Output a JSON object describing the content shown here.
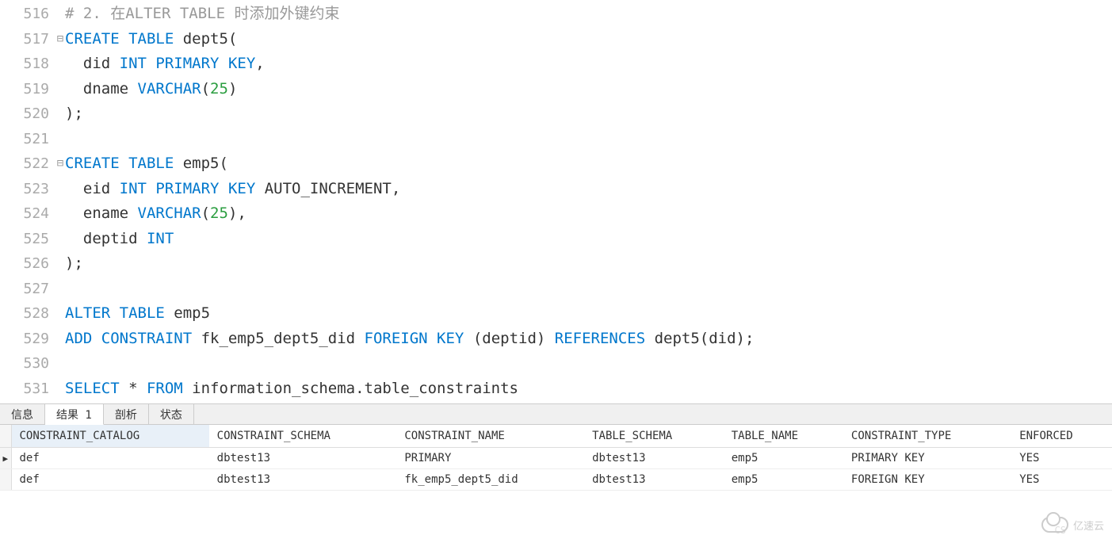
{
  "editor": {
    "lines": [
      {
        "num": "516",
        "fold": "",
        "tokens": [
          {
            "t": "# 2. 在ALTER TABLE 时添加外键约束",
            "c": "comment"
          }
        ]
      },
      {
        "num": "517",
        "fold": "⊟",
        "tokens": [
          {
            "t": "CREATE",
            "c": "kw"
          },
          {
            "t": " "
          },
          {
            "t": "TABLE",
            "c": "kw"
          },
          {
            "t": " dept5("
          }
        ]
      },
      {
        "num": "518",
        "fold": "",
        "tokens": [
          {
            "t": "  did "
          },
          {
            "t": "INT",
            "c": "kw"
          },
          {
            "t": " "
          },
          {
            "t": "PRIMARY",
            "c": "kw"
          },
          {
            "t": " "
          },
          {
            "t": "KEY",
            "c": "kw"
          },
          {
            "t": ","
          }
        ]
      },
      {
        "num": "519",
        "fold": "",
        "tokens": [
          {
            "t": "  dname "
          },
          {
            "t": "VARCHAR",
            "c": "kw"
          },
          {
            "t": "("
          },
          {
            "t": "25",
            "c": "num"
          },
          {
            "t": ")"
          }
        ]
      },
      {
        "num": "520",
        "fold": "",
        "tokens": [
          {
            "t": ");"
          }
        ]
      },
      {
        "num": "521",
        "fold": "",
        "tokens": [
          {
            "t": ""
          }
        ]
      },
      {
        "num": "522",
        "fold": "⊟",
        "tokens": [
          {
            "t": "CREATE",
            "c": "kw"
          },
          {
            "t": " "
          },
          {
            "t": "TABLE",
            "c": "kw"
          },
          {
            "t": " emp5("
          }
        ]
      },
      {
        "num": "523",
        "fold": "",
        "tokens": [
          {
            "t": "  eid "
          },
          {
            "t": "INT",
            "c": "kw"
          },
          {
            "t": " "
          },
          {
            "t": "PRIMARY",
            "c": "kw"
          },
          {
            "t": " "
          },
          {
            "t": "KEY",
            "c": "kw"
          },
          {
            "t": " AUTO_INCREMENT,"
          }
        ]
      },
      {
        "num": "524",
        "fold": "",
        "tokens": [
          {
            "t": "  ename "
          },
          {
            "t": "VARCHAR",
            "c": "kw"
          },
          {
            "t": "("
          },
          {
            "t": "25",
            "c": "num"
          },
          {
            "t": "),"
          }
        ]
      },
      {
        "num": "525",
        "fold": "",
        "tokens": [
          {
            "t": "  deptid "
          },
          {
            "t": "INT",
            "c": "kw"
          }
        ]
      },
      {
        "num": "526",
        "fold": "",
        "tokens": [
          {
            "t": ");"
          }
        ]
      },
      {
        "num": "527",
        "fold": "",
        "tokens": [
          {
            "t": ""
          }
        ]
      },
      {
        "num": "528",
        "fold": "",
        "tokens": [
          {
            "t": "ALTER",
            "c": "kw"
          },
          {
            "t": " "
          },
          {
            "t": "TABLE",
            "c": "kw"
          },
          {
            "t": " emp5"
          }
        ]
      },
      {
        "num": "529",
        "fold": "",
        "tokens": [
          {
            "t": "ADD",
            "c": "kw"
          },
          {
            "t": " "
          },
          {
            "t": "CONSTRAINT",
            "c": "kw"
          },
          {
            "t": " fk_emp5_dept5_did "
          },
          {
            "t": "FOREIGN",
            "c": "kw"
          },
          {
            "t": " "
          },
          {
            "t": "KEY",
            "c": "kw"
          },
          {
            "t": " (deptid) "
          },
          {
            "t": "REFERENCES",
            "c": "kw"
          },
          {
            "t": " dept5(did);"
          }
        ]
      },
      {
        "num": "530",
        "fold": "",
        "tokens": [
          {
            "t": ""
          }
        ]
      },
      {
        "num": "531",
        "fold": "",
        "tokens": [
          {
            "t": "SELECT",
            "c": "kw"
          },
          {
            "t": " * "
          },
          {
            "t": "FROM",
            "c": "kw"
          },
          {
            "t": " information_schema.table_constraints"
          }
        ]
      }
    ]
  },
  "tabs": {
    "items": [
      "信息",
      "结果 1",
      "剖析",
      "状态"
    ],
    "active_index": 1
  },
  "results": {
    "columns": [
      "CONSTRAINT_CATALOG",
      "CONSTRAINT_SCHEMA",
      "CONSTRAINT_NAME",
      "TABLE_SCHEMA",
      "TABLE_NAME",
      "CONSTRAINT_TYPE",
      "ENFORCED"
    ],
    "rows": [
      {
        "marker": "▶",
        "cells": [
          "def",
          "dbtest13",
          "PRIMARY",
          "dbtest13",
          "emp5",
          "PRIMARY KEY",
          "YES"
        ]
      },
      {
        "marker": "",
        "cells": [
          "def",
          "dbtest13",
          "fk_emp5_dept5_did",
          "dbtest13",
          "emp5",
          "FOREIGN KEY",
          "YES"
        ]
      }
    ]
  },
  "watermark": {
    "text": "亿速云",
    "cs": "CS"
  }
}
